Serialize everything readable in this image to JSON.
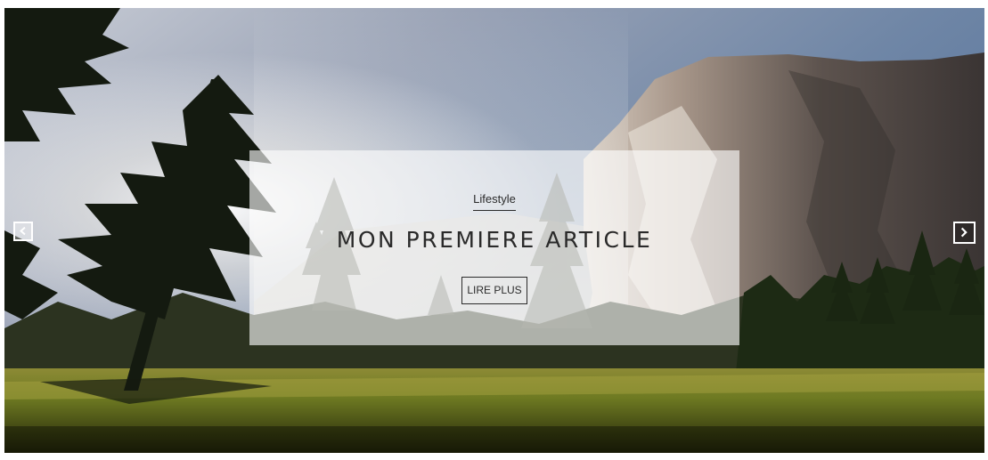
{
  "slide": {
    "category": "Lifestyle",
    "title": "MON PREMIERE ARTICLE",
    "read_more_label": "LIRE PLUS"
  },
  "controls": {
    "prev_icon": "chevron-left-icon",
    "next_icon": "chevron-right-icon"
  },
  "colors": {
    "overlay": "#ffffff",
    "text": "#2b2b2b",
    "arrow": "#ffffff"
  }
}
